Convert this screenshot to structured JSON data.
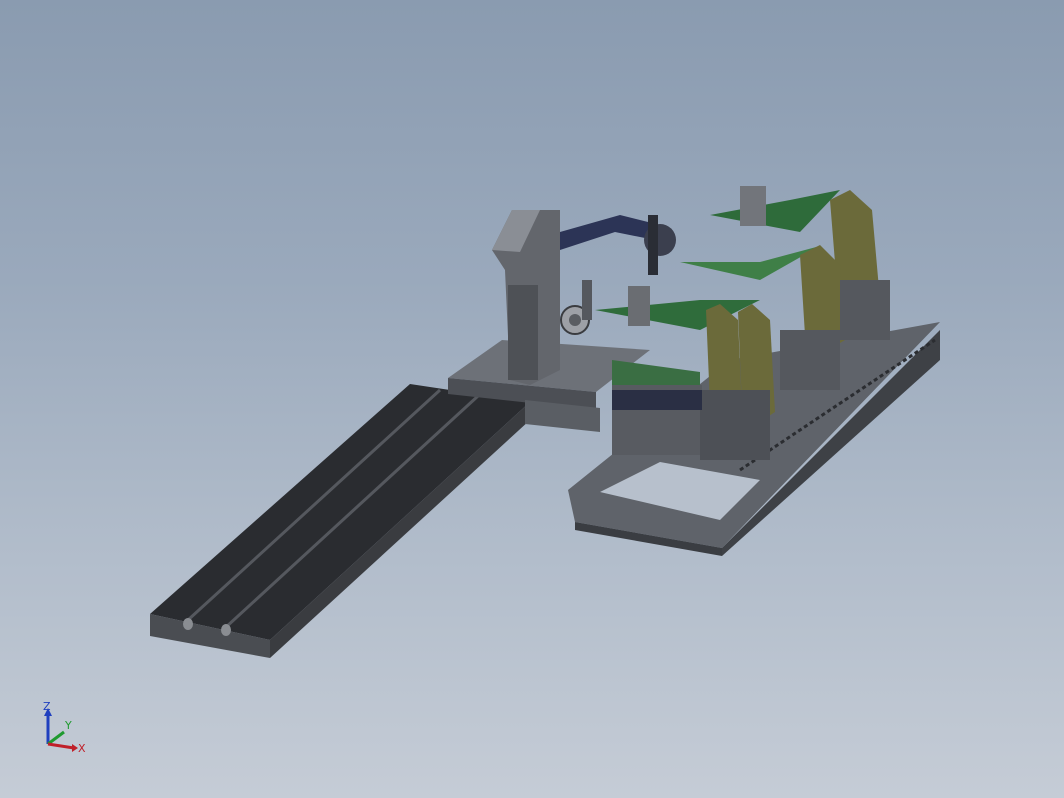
{
  "viewport": {
    "background_top": "#8a9bb0",
    "background_bottom": "#c5ccd6"
  },
  "model": {
    "colors": {
      "steel_dark": "#3a3d42",
      "steel_mid": "#5b5f66",
      "steel_light": "#7c8088",
      "green_panel": "#2e6b3a",
      "green_light": "#4d8c52",
      "olive_clamp": "#6b6a3a",
      "navy_arm": "#2c3456"
    }
  },
  "triad": {
    "z_label": "Z",
    "y_label": "Y",
    "x_label": "X",
    "z_color": "#1f3fbf",
    "y_color": "#1f9a2f",
    "x_color": "#c0202a"
  }
}
